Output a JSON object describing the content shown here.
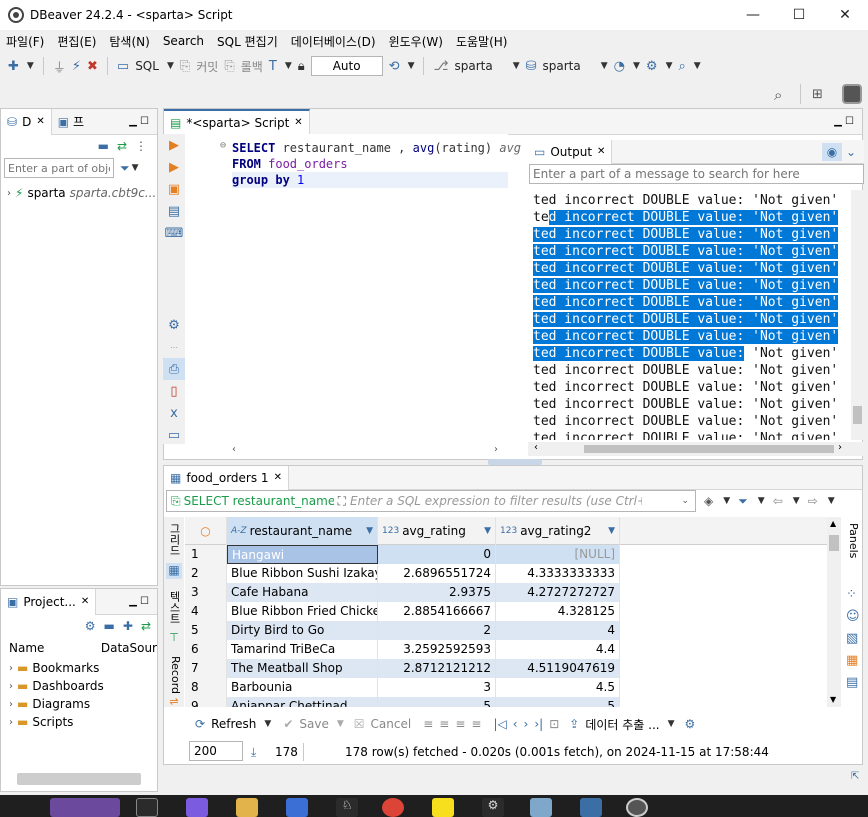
{
  "window": {
    "title": "DBeaver 24.2.4 - <sparta> Script",
    "minimize": "—",
    "maximize": "☐",
    "close": "✕"
  },
  "menu": [
    "파일(F)",
    "편집(E)",
    "탐색(N)",
    "Search",
    "SQL 편집기",
    "데이터베이스(D)",
    "윈도우(W)",
    "도움말(H)"
  ],
  "toolbar": {
    "sql": "SQL",
    "commit": "커밋",
    "rollback": "롤백",
    "auto": "Auto",
    "datasource": "sparta",
    "schema": "sparta"
  },
  "navigator": {
    "tab1": "D",
    "tab2": "프",
    "filter_placeholder": "Enter a part of obje",
    "node_name": "sparta",
    "node_detail": "sparta.cbt9c..."
  },
  "projects": {
    "tab": "Project...",
    "col_name": "Name",
    "col_ds": "DataSour",
    "items": [
      "Bookmarks",
      "Dashboards",
      "Diagrams",
      "Scripts"
    ]
  },
  "editor": {
    "tab": "*<sparta> Script",
    "lines": [
      {
        "kw": "SELECT",
        "rest1": " restaurant_name , ",
        "fn": "avg",
        "rest2": "(rating) ",
        "dim": "avg"
      },
      {
        "kw": "FROM",
        "tbl": " food_orders"
      },
      {
        "kw": "group by",
        "num": " 1"
      }
    ]
  },
  "output": {
    "tab": "Output",
    "search_placeholder": "Enter a part of a message to search for here",
    "lines": [
      {
        "pre": "ted incorrect DOUBLE value: 'Not given'",
        "sel": "",
        "post": ""
      },
      {
        "pre": "te",
        "sel": "d incorrect DOUBLE value: 'Not given'",
        "post": ""
      },
      {
        "pre": "",
        "sel": "ted incorrect DOUBLE value: 'Not given'",
        "post": ""
      },
      {
        "pre": "",
        "sel": "ted incorrect DOUBLE value: 'Not given'",
        "post": ""
      },
      {
        "pre": "",
        "sel": "ted incorrect DOUBLE value: 'Not given'",
        "post": ""
      },
      {
        "pre": "",
        "sel": "ted incorrect DOUBLE value: 'Not given'",
        "post": ""
      },
      {
        "pre": "",
        "sel": "ted incorrect DOUBLE value: 'Not given'",
        "post": ""
      },
      {
        "pre": "",
        "sel": "ted incorrect DOUBLE value: 'Not given'",
        "post": ""
      },
      {
        "pre": "",
        "sel": "ted incorrect DOUBLE value: 'Not given'",
        "post": ""
      },
      {
        "pre": "",
        "sel": "ted incorrect DOUBLE value:",
        "post": " 'Not given'"
      },
      {
        "pre": "ted incorrect DOUBLE value: 'Not given'",
        "sel": "",
        "post": ""
      },
      {
        "pre": "ted incorrect DOUBLE value: 'Not given'",
        "sel": "",
        "post": ""
      },
      {
        "pre": "ted incorrect DOUBLE value: 'Not given'",
        "sel": "",
        "post": ""
      },
      {
        "pre": "ted incorrect DOUBLE value: 'Not given'",
        "sel": "",
        "post": ""
      },
      {
        "pre": "ted incorrect DOUBLE value: 'Not given'",
        "sel": "",
        "post": ""
      }
    ]
  },
  "results": {
    "tab": "food_orders 1",
    "filter_sql": "SELECT restaurant_name , a",
    "filter_placeholder": "Enter a SQL expression to filter results (use Ctrl+Spac",
    "side_labels": [
      "그리드",
      "텍스트",
      "Record"
    ],
    "columns": [
      {
        "type": "A-Z",
        "name": "restaurant_name"
      },
      {
        "type": "123",
        "name": "avg_rating"
      },
      {
        "type": "123",
        "name": "avg_rating2"
      }
    ],
    "rows": [
      [
        "1",
        "Hangawi",
        "0",
        "[NULL]"
      ],
      [
        "2",
        "Blue Ribbon Sushi Izakaya",
        "2.6896551724",
        "4.3333333333"
      ],
      [
        "3",
        "Cafe Habana",
        "2.9375",
        "4.2727272727"
      ],
      [
        "4",
        "Blue Ribbon Fried Chicken",
        "2.8854166667",
        "4.328125"
      ],
      [
        "5",
        "Dirty Bird to Go",
        "2",
        "4"
      ],
      [
        "6",
        "Tamarind TriBeCa",
        "3.2592592593",
        "4.4"
      ],
      [
        "7",
        "The Meatball Shop",
        "2.8712121212",
        "4.5119047619"
      ],
      [
        "8",
        "Barbounia",
        "3",
        "4.5"
      ],
      [
        "9",
        "Anjappar Chettinad",
        "5",
        "5"
      ]
    ],
    "panels_label": "Panels",
    "refresh": "Refresh",
    "save": "Save",
    "cancel": "Cancel",
    "export": "데이터 추출 ...",
    "limit": "200",
    "count": "178",
    "status": "178 row(s) fetched - 0.020s (0.001s fetch), on 2024-11-15 at 17:58:44"
  }
}
